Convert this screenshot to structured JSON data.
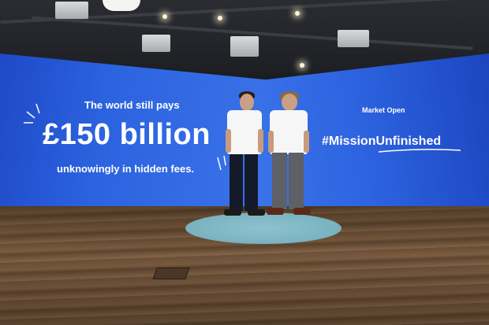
{
  "photo": {
    "screen_left": {
      "line1": "The world still pays",
      "line2": "£150 billion",
      "line3": "unknowingly in hidden fees."
    },
    "screen_right": {
      "label": "Market Open",
      "hashtag": "#MissionUnfinished"
    },
    "colors": {
      "screen_blue": "#2c64e0",
      "text": "#ffffff",
      "floor_wood": "#7c5d41",
      "rug": "#79b2c0"
    }
  }
}
